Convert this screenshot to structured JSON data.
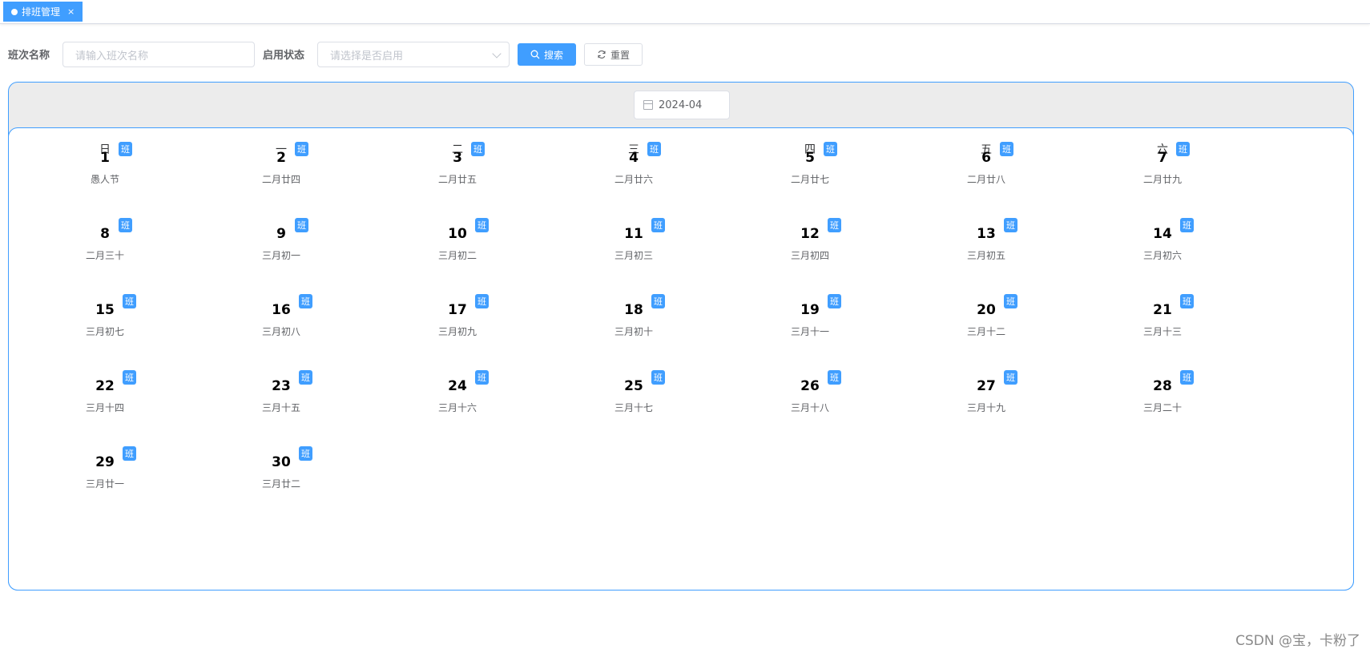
{
  "tabs": [
    {
      "label": "排班管理",
      "close": "×"
    }
  ],
  "search": {
    "name_label": "班次名称",
    "name_placeholder": "请输入班次名称",
    "status_label": "启用状态",
    "status_placeholder": "请选择是否启用",
    "search_button": "搜索",
    "reset_button": "重置"
  },
  "calendar": {
    "month": "2024-04",
    "weekdays": [
      "日",
      "一",
      "二",
      "三",
      "四",
      "五",
      "六"
    ],
    "badge": "班",
    "days": [
      {
        "day": "1",
        "lunar": "愚人节"
      },
      {
        "day": "2",
        "lunar": "二月廿四"
      },
      {
        "day": "3",
        "lunar": "二月廿五"
      },
      {
        "day": "4",
        "lunar": "二月廿六"
      },
      {
        "day": "5",
        "lunar": "二月廿七"
      },
      {
        "day": "6",
        "lunar": "二月廿八"
      },
      {
        "day": "7",
        "lunar": "二月廿九"
      },
      {
        "day": "8",
        "lunar": "二月三十"
      },
      {
        "day": "9",
        "lunar": "三月初一"
      },
      {
        "day": "10",
        "lunar": "三月初二"
      },
      {
        "day": "11",
        "lunar": "三月初三"
      },
      {
        "day": "12",
        "lunar": "三月初四"
      },
      {
        "day": "13",
        "lunar": "三月初五"
      },
      {
        "day": "14",
        "lunar": "三月初六"
      },
      {
        "day": "15",
        "lunar": "三月初七"
      },
      {
        "day": "16",
        "lunar": "三月初八"
      },
      {
        "day": "17",
        "lunar": "三月初九"
      },
      {
        "day": "18",
        "lunar": "三月初十"
      },
      {
        "day": "19",
        "lunar": "三月十一"
      },
      {
        "day": "20",
        "lunar": "三月十二"
      },
      {
        "day": "21",
        "lunar": "三月十三"
      },
      {
        "day": "22",
        "lunar": "三月十四"
      },
      {
        "day": "23",
        "lunar": "三月十五"
      },
      {
        "day": "24",
        "lunar": "三月十六"
      },
      {
        "day": "25",
        "lunar": "三月十七"
      },
      {
        "day": "26",
        "lunar": "三月十八"
      },
      {
        "day": "27",
        "lunar": "三月十九"
      },
      {
        "day": "28",
        "lunar": "三月二十"
      },
      {
        "day": "29",
        "lunar": "三月廿一"
      },
      {
        "day": "30",
        "lunar": "三月廿二"
      }
    ]
  },
  "watermark": "CSDN @宝，卡粉了",
  "colors": {
    "accent": "#409eff",
    "header_bg": "#ececec"
  },
  "icons": {
    "search": "search-icon",
    "reset": "refresh-icon",
    "date": "calendar-icon"
  }
}
